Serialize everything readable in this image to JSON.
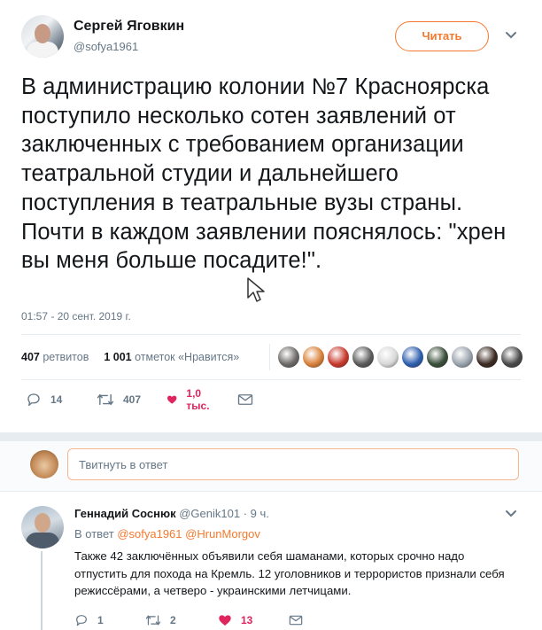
{
  "tweet": {
    "author_name": "Сергей Яговкин",
    "author_handle": "@sofya1961",
    "follow_label": "Читать",
    "text": "В администрацию колонии №7 Красноярска поступило несколько сотен заявлений от заключенных с требованием организации театральной студии и дальнейшего поступления в театральные вузы страны. Почти в каждом заявлении пояснялось: \"хрен вы меня больше посадите!\".",
    "time": "01:57 - 20 сент. 2019 г.",
    "retweets_count": "407",
    "retweets_label": "ретвитов",
    "likes_count": "1 001",
    "likes_label": "отметок «Нравится»",
    "actions": {
      "replies": "14",
      "retweets": "407",
      "likes": "1,0 тыс."
    },
    "liker_avatar_colors": [
      "#6d6a68",
      "#d9823a",
      "#c8392d",
      "#5b5b5b",
      "#d8d8d8",
      "#2f5fae",
      "#3a4f3a",
      "#9aa3ad",
      "#3b2a22",
      "#4a4a4a"
    ]
  },
  "reply_box": {
    "placeholder": "Твитнуть в ответ"
  },
  "comment": {
    "author_name": "Геннадий Соснюк",
    "author_handle": "@Genik101",
    "time": "· 9 ч.",
    "reply_prefix": "В ответ",
    "reply_to_1": "@sofya1961",
    "reply_to_2": "@HrunMorgov",
    "text": "Также 42 заключённых объявили себя шаманами, которых срочно надо отпустить для похода на Кремль. 12 уголовников и террористов признали себя режиссёрами,  а четверо - украинскими летчицами.",
    "actions": {
      "replies": "1",
      "retweets": "2",
      "likes": "13"
    }
  },
  "colors": {
    "accent": "#f4792f",
    "like": "#e0245e",
    "muted": "#657786",
    "text": "#14171a"
  }
}
